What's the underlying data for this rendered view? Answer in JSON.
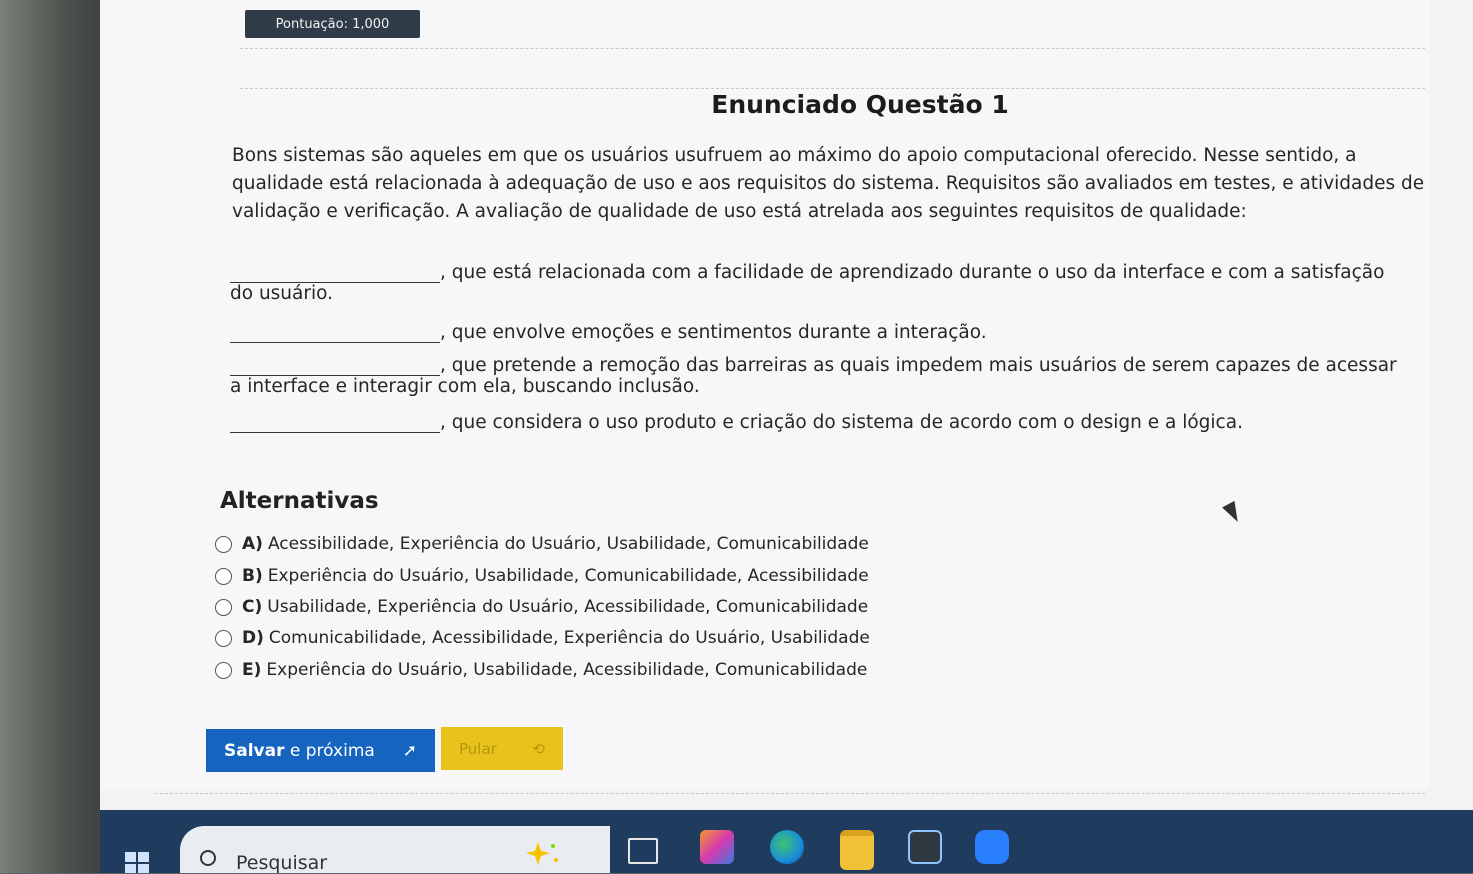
{
  "header": {
    "score_label": "Pontuação: 1,000"
  },
  "question": {
    "title": "Enunciado Questão 1",
    "statement": "Bons sistemas são aqueles em que os usuários usufruem ao máximo do apoio computacional oferecido. Nesse sentido, a qualidade está relacionada à adequação de uso e aos requisitos do sistema. Requisitos são avaliados em testes, e atividades de validação e verificação. A avaliação de qualidade de uso está atrelada aos seguintes requisitos de qualidade:",
    "gaps": [
      ", que está relacionada com a facilidade de aprendizado durante o uso da interface e com a satisfação do usuário.",
      ", que envolve emoções e sentimentos durante a interação.",
      ", que pretende a remoção das barreiras as quais impedem mais usuários de serem capazes de acessar a interface e interagir com ela, buscando inclusão.",
      ", que considera o uso produto e criação do sistema de acordo com o design e a lógica."
    ]
  },
  "alternatives": {
    "title": "Alternativas",
    "options": [
      {
        "letter": "A)",
        "text": "Acessibilidade, Experiência do Usuário, Usabilidade, Comunicabilidade"
      },
      {
        "letter": "B)",
        "text": "Experiência do Usuário, Usabilidade, Comunicabilidade, Acessibilidade"
      },
      {
        "letter": "C)",
        "text": "Usabilidade, Experiência do Usuário, Acessibilidade, Comunicabilidade"
      },
      {
        "letter": "D)",
        "text": "Comunicabilidade, Acessibilidade, Experiência do Usuário, Usabilidade"
      },
      {
        "letter": "E)",
        "text": "Experiência do Usuário, Usabilidade, Acessibilidade, Comunicabilidade"
      }
    ]
  },
  "actions": {
    "save_label_bold": "Salvar",
    "save_label_rest": " e próxima",
    "save_icon": "arrow-icon",
    "skip_label": "Pular",
    "skip_icon": "clock-icon"
  },
  "taskbar": {
    "search_placeholder": "Pesquisar"
  }
}
